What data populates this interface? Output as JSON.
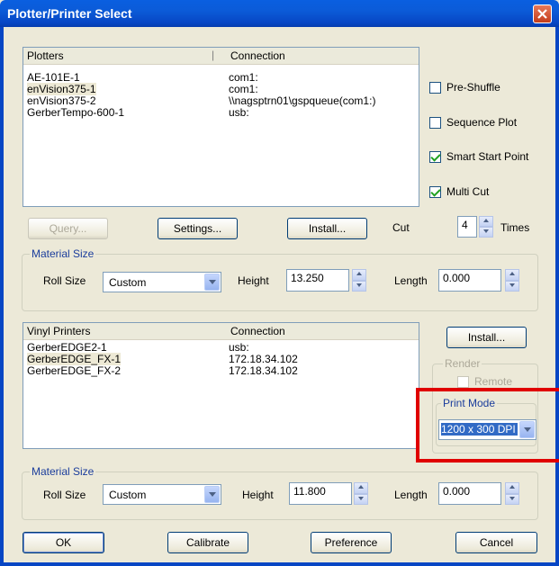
{
  "window": {
    "title": "Plotter/Printer Select"
  },
  "plotters": {
    "columns": [
      "Plotters",
      "Connection"
    ],
    "rows": [
      {
        "name": "AE-101E-1",
        "connection": "com1:"
      },
      {
        "name": "enVision375-1",
        "connection": "com1:"
      },
      {
        "name": "enVision375-2",
        "connection": "\\\\nagsptrn01\\gspqueue(com1:)"
      },
      {
        "name": "GerberTempo-600-1",
        "connection": "usb:"
      }
    ]
  },
  "options": {
    "pre_shuffle": "Pre-Shuffle",
    "sequence_plot": "Sequence Plot",
    "smart_start_point": "Smart Start Point",
    "multi_cut": "Multi Cut"
  },
  "buttons": {
    "query": "Query...",
    "settings": "Settings...",
    "install": "Install...",
    "install2": "Install...",
    "ok": "OK",
    "calibrate": "Calibrate",
    "preference": "Preference",
    "cancel": "Cancel"
  },
  "cut": {
    "label": "Cut",
    "value": "4",
    "times": "Times"
  },
  "material1": {
    "group_label": "Material Size",
    "roll_label": "Roll Size",
    "roll_value": "Custom",
    "height_label": "Height",
    "height_value": "13.250",
    "length_label": "Length",
    "length_value": "0.000"
  },
  "vinyl": {
    "columns": [
      "Vinyl Printers",
      "Connection"
    ],
    "rows": [
      {
        "name": "GerberEDGE2-1",
        "connection": "usb:"
      },
      {
        "name": "GerberEDGE_FX-1",
        "connection": "172.18.34.102"
      },
      {
        "name": "GerberEDGE_FX-2",
        "connection": "172.18.34.102"
      }
    ]
  },
  "render": {
    "group_label": "Render",
    "remote": "Remote"
  },
  "print_mode": {
    "group_label": "Print Mode",
    "value": "1200 x 300 DPI"
  },
  "material2": {
    "group_label": "Material Size",
    "roll_label": "Roll Size",
    "roll_value": "Custom",
    "height_label": "Height",
    "height_value": "11.800",
    "length_label": "Length",
    "length_value": "0.000"
  },
  "colors": {
    "titlebar": "#0a5fe0",
    "highlight_box": "#e00000",
    "dialog_bg": "#ece9d8"
  }
}
